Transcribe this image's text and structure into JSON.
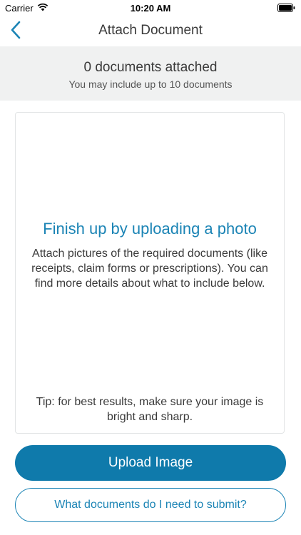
{
  "status_bar": {
    "carrier": "Carrier",
    "time": "10:20 AM",
    "wifi_icon": "wifi-icon",
    "battery_icon": "battery-icon"
  },
  "nav": {
    "title": "Attach Document",
    "back_icon": "chevron-left-icon"
  },
  "summary": {
    "count_text": "0 documents attached",
    "limit_text": "You may include up to 10 documents"
  },
  "upload_card": {
    "heading": "Finish up by uploading a photo",
    "body": "Attach pictures of the required documents (like receipts, claim forms or prescriptions). You can find more details about what to include below.",
    "tip": "Tip: for best results, make sure your image is bright and sharp."
  },
  "actions": {
    "upload_label": "Upload Image",
    "docs_label": "What documents do I need to submit?"
  },
  "colors": {
    "accent": "#1b84b5",
    "primary_button": "#0f7aab",
    "banner_bg": "#f0f1f1"
  }
}
